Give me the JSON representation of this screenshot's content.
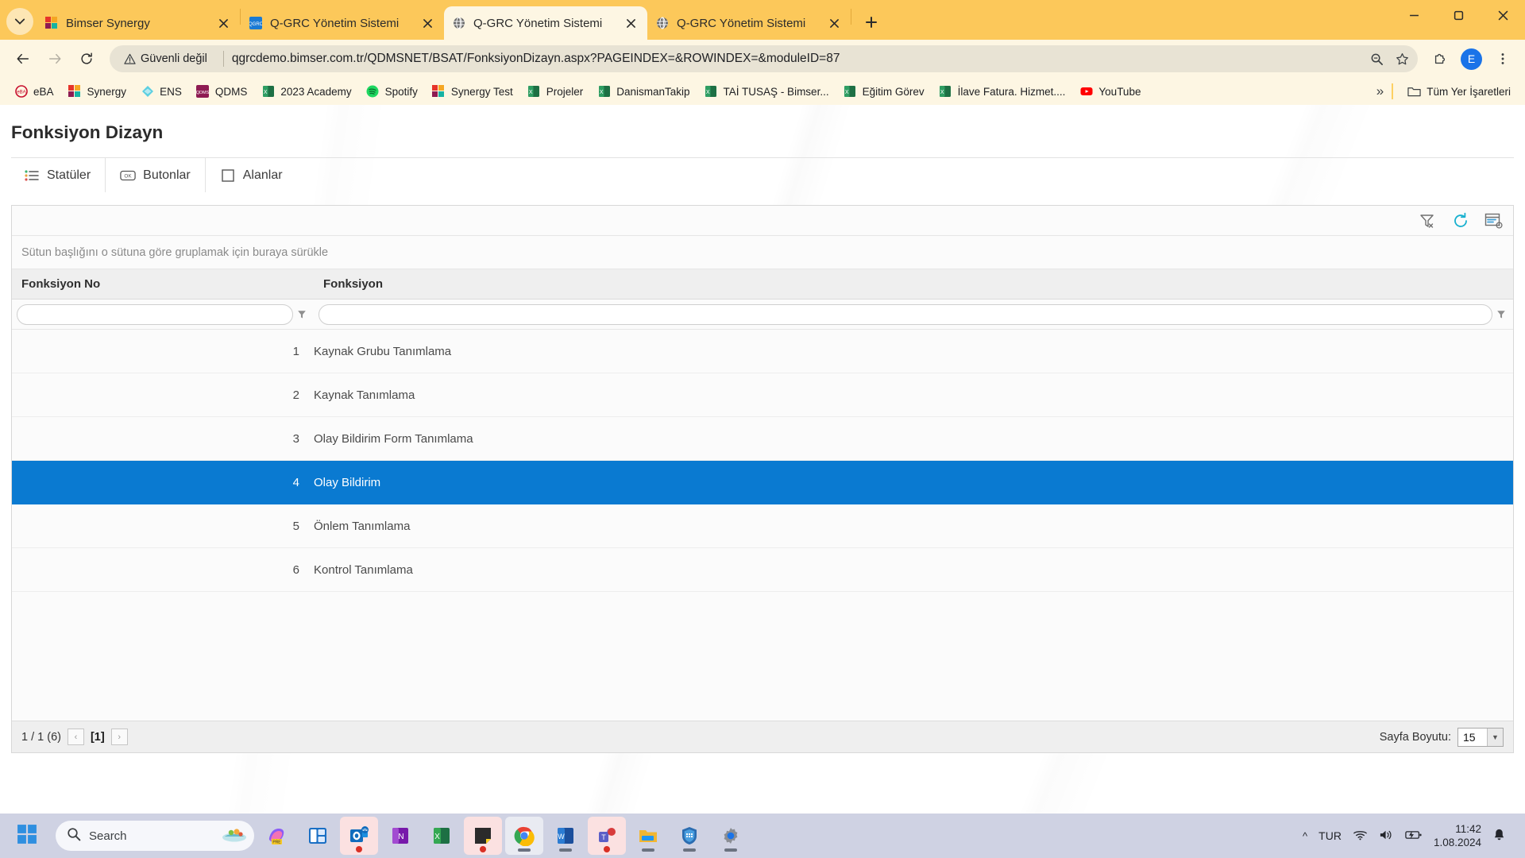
{
  "browser": {
    "tabs": [
      {
        "title": "Bimser Synergy",
        "favicon": "bimser-icon",
        "active": false
      },
      {
        "title": "Q-GRC Yönetim Sistemi",
        "favicon": "qgrc-icon",
        "active": false
      },
      {
        "title": "Q-GRC Yönetim Sistemi",
        "favicon": "globe-icon",
        "active": true
      },
      {
        "title": "Q-GRC Yönetim Sistemi",
        "favicon": "globe-icon",
        "active": false
      }
    ],
    "new_tab_label": "+",
    "window_controls": {
      "minimize": "minimize-icon",
      "maximize": "maximize-icon",
      "close": "close-icon"
    },
    "address": {
      "security_label": "Güvenli değil",
      "url": "qgrcdemo.bimser.com.tr/QDMSNET/BSAT/FonksiyonDizayn.aspx?PAGEINDEX=&ROWINDEX=&moduleID=87",
      "profile_initial": "E"
    },
    "bookmarks": [
      {
        "label": "eBA",
        "icon": "eba-icon"
      },
      {
        "label": "Synergy",
        "icon": "bimser-icon"
      },
      {
        "label": "ENS",
        "icon": "ens-icon"
      },
      {
        "label": "QDMS",
        "icon": "qdms-icon"
      },
      {
        "label": "2023 Academy",
        "icon": "excel-icon"
      },
      {
        "label": "Spotify",
        "icon": "spotify-icon"
      },
      {
        "label": "Synergy Test",
        "icon": "bimser-icon"
      },
      {
        "label": "Projeler",
        "icon": "excel-icon"
      },
      {
        "label": "DanismanTakip",
        "icon": "excel-icon"
      },
      {
        "label": "TAİ TUSAŞ - Bimser...",
        "icon": "excel-icon"
      },
      {
        "label": "Eğitim Görev",
        "icon": "excel-icon"
      },
      {
        "label": "İlave Fatura. Hizmet....",
        "icon": "excel-icon"
      },
      {
        "label": "YouTube",
        "icon": "youtube-icon"
      }
    ],
    "bookmarks_overflow": "»",
    "all_bookmarks_label": "Tüm Yer İşaretleri"
  },
  "page": {
    "title": "Fonksiyon Dizayn",
    "tabs": [
      {
        "label": "Statüler",
        "icon": "list-status-icon"
      },
      {
        "label": "Butonlar",
        "icon": "ok-button-icon"
      },
      {
        "label": "Alanlar",
        "icon": "square-field-icon"
      }
    ],
    "grid": {
      "toolbar": [
        {
          "name": "clear-filter-icon"
        },
        {
          "name": "refresh-icon"
        },
        {
          "name": "column-settings-icon"
        }
      ],
      "group_hint": "Sütun başlığını o sütuna göre gruplamak için buraya sürükle",
      "columns": [
        "Fonksiyon No",
        "Fonksiyon"
      ],
      "filters": {
        "no_value": "",
        "name_value": ""
      },
      "rows": [
        {
          "no": "1",
          "name": "Kaynak Grubu Tanımlama",
          "selected": false
        },
        {
          "no": "2",
          "name": "Kaynak Tanımlama",
          "selected": false
        },
        {
          "no": "3",
          "name": "Olay Bildirim Form Tanımlama",
          "selected": false
        },
        {
          "no": "4",
          "name": "Olay Bildirim",
          "selected": true
        },
        {
          "no": "5",
          "name": "Önlem Tanımlama",
          "selected": false
        },
        {
          "no": "6",
          "name": "Kontrol Tanımlama",
          "selected": false
        }
      ],
      "footer": {
        "summary": "1 / 1 (6)",
        "prev": "‹",
        "current_page": "[1]",
        "next": "›",
        "page_size_label": "Sayfa Boyutu:",
        "page_size_value": "15"
      }
    },
    "selection_color": "#0a7ad1"
  },
  "taskbar": {
    "start": "windows-start-icon",
    "search_placeholder": "Search",
    "apps": [
      {
        "name": "copilot-icon",
        "badge": "none"
      },
      {
        "name": "widgets-icon",
        "badge": "none"
      },
      {
        "name": "outlook-icon",
        "badge": "dot"
      },
      {
        "name": "onenote-icon",
        "badge": "none"
      },
      {
        "name": "excel-icon",
        "badge": "none"
      },
      {
        "name": "sticky-notes-icon",
        "badge": "dot"
      },
      {
        "name": "chrome-icon",
        "badge": "underline"
      },
      {
        "name": "word-icon",
        "badge": "underline"
      },
      {
        "name": "teams-icon",
        "badge": "dot"
      },
      {
        "name": "file-explorer-icon",
        "badge": "underline"
      },
      {
        "name": "security-shield-icon",
        "badge": "underline"
      },
      {
        "name": "settings-gear-icon",
        "badge": "underline"
      }
    ],
    "tray": {
      "overflow": "^",
      "language": "TUR",
      "wifi": "wifi-icon",
      "volume": "volume-icon",
      "battery": "battery-charging-icon",
      "time": "11:42",
      "date": "1.08.2024",
      "notifications": "bell-icon"
    }
  }
}
